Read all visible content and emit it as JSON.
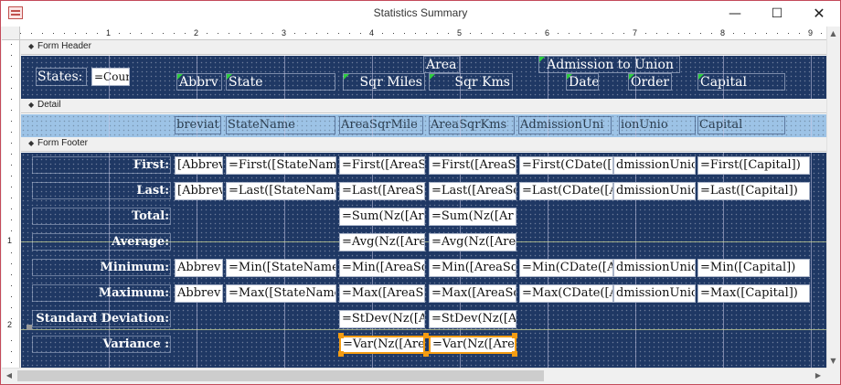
{
  "window": {
    "title": "Statistics Summary"
  },
  "controls": {
    "minimize": "—",
    "maximize": "☐",
    "close": "✕"
  },
  "ruler": {
    "h_numbers": [
      "1",
      "2",
      "3",
      "4",
      "5",
      "6",
      "7",
      "8",
      "9"
    ],
    "v_numbers": [
      "1",
      "2"
    ]
  },
  "sections": {
    "header": "Form Header",
    "detail": "Detail",
    "footer": "Form Footer"
  },
  "header": {
    "states_label": "States:",
    "count_field": "=Coun",
    "col_abbrev": "Abbrv",
    "col_state": "State",
    "col_area": "Area",
    "col_sqr_miles": "Sqr Miles",
    "col_sqr_kms": "Sqr Kms",
    "col_admission": "Admission to Union",
    "col_date": "Date",
    "col_order": "Order",
    "col_capital": "Capital"
  },
  "detail": {
    "abbrev": "breviat",
    "state": "StateName",
    "area_sqr_miles": "AreaSqrMile",
    "area_sqr_kms": "AreaSqrKms",
    "admission_union": "AdmissionUni",
    "admission_order": "ionUnio",
    "capital": "Capital"
  },
  "footer": {
    "rows": [
      {
        "label": "First:",
        "abbrev": "[Abbrev",
        "state": "=First([StateNam",
        "miles": "=First([AreaS",
        "kms": "=First([AreaS",
        "date": "=First(CDate([",
        "order": "dmissionUnic",
        "capital": "=First([Capital])"
      },
      {
        "label": "Last:",
        "abbrev": "[Abbrev",
        "state": "=Last([StateName",
        "miles": "=Last([AreaS",
        "kms": "=Last([AreaSq",
        "date": "=Last(CDate([A",
        "order": "dmissionUnic",
        "capital": "=Last([Capital])"
      },
      {
        "label": "Total:",
        "miles": "=Sum(Nz([Ar",
        "kms": "=Sum(Nz([Ar"
      },
      {
        "label": "Average:",
        "miles": "=Avg(Nz([Are",
        "kms": "=Avg(Nz([Are"
      },
      {
        "label": "Minimum:",
        "abbrev": "Abbrev",
        "state": "=Min([StateName]",
        "miles": "=Min([AreaSq",
        "kms": "=Min([AreaSq",
        "date": "=Min(CDate([A",
        "order": "dmissionUnio",
        "capital": "=Min([Capital])"
      },
      {
        "label": "Maximum:",
        "abbrev": "Abbrev",
        "state": "=Max([StateName",
        "miles": "=Max([AreaS",
        "kms": "=Max([AreaSq",
        "date": "=Max(CDate([A",
        "order": "dmissionUnio",
        "capital": "=Max([Capital])"
      },
      {
        "label": "Standard Deviation:",
        "miles": "=StDev(Nz([A",
        "kms": "=StDev(Nz([A"
      },
      {
        "label": "Variance :",
        "miles": "=Var(Nz([Are",
        "kms": "=Var(Nz([Are"
      }
    ]
  },
  "colors": {
    "section_bg": "#1f3864",
    "detail_bg": "#9dc3e6",
    "selection": "#f39c12",
    "window_border": "#c44a5a"
  }
}
